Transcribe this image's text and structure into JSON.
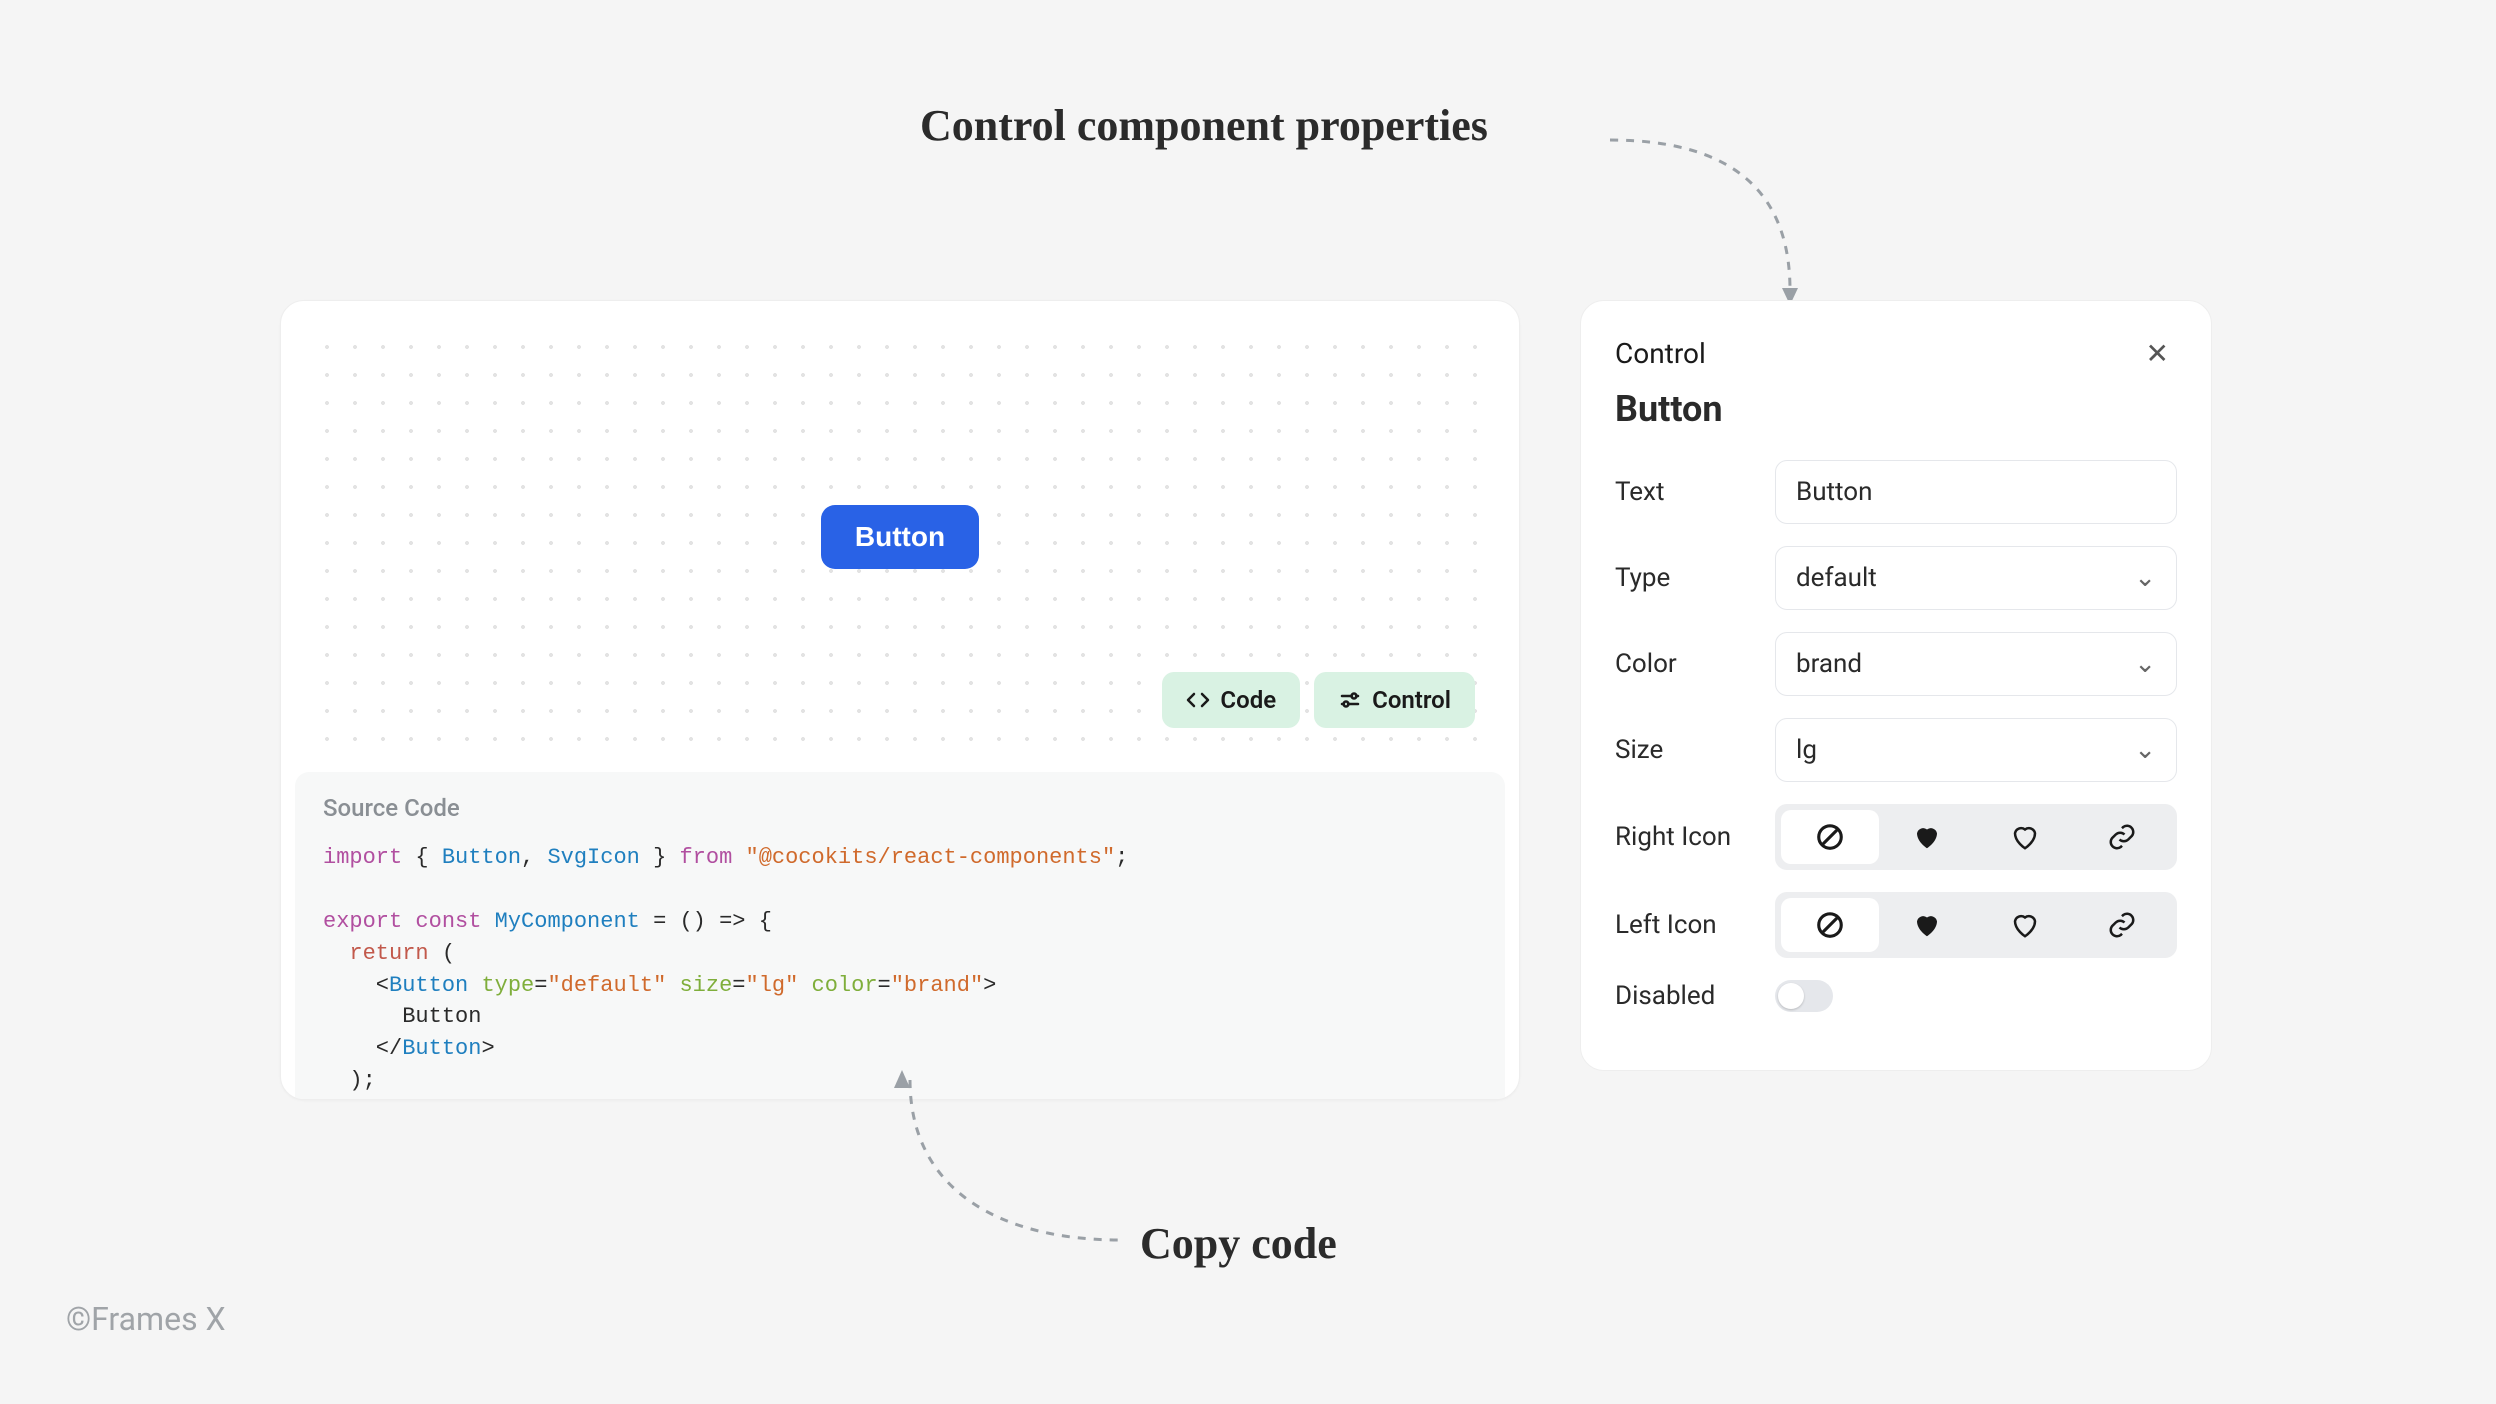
{
  "annotations": {
    "top": "Control component properties",
    "bottom": "Copy code"
  },
  "preview": {
    "button_text": "Button",
    "actions": {
      "code": "Code",
      "control": "Control"
    }
  },
  "source": {
    "title": "Source Code",
    "code": {
      "import_kw": "import",
      "import_names": [
        "Button",
        "SvgIcon"
      ],
      "from_kw": "from",
      "package": "\"@cocokits/react-components\"",
      "export_kw": "export",
      "const_kw": "const",
      "component_name": "MyComponent",
      "return_kw": "return",
      "jsx_tag": "Button",
      "attr_type": "type",
      "val_type": "\"default\"",
      "attr_size": "size",
      "val_size": "\"lg\"",
      "attr_color": "color",
      "val_color": "\"brand\"",
      "inner_text": "Button"
    }
  },
  "control": {
    "panel_title": "Control",
    "component_name": "Button",
    "props": {
      "text": {
        "label": "Text",
        "value": "Button"
      },
      "type": {
        "label": "Type",
        "value": "default"
      },
      "color": {
        "label": "Color",
        "value": "brand"
      },
      "size": {
        "label": "Size",
        "value": "lg"
      },
      "right_icon": {
        "label": "Right Icon",
        "selected": "none"
      },
      "left_icon": {
        "label": "Left Icon",
        "selected": "none"
      },
      "disabled": {
        "label": "Disabled",
        "value": false
      }
    },
    "icon_options": [
      "none",
      "heart-solid",
      "heart-outline",
      "link"
    ]
  },
  "footer": "©Frames X"
}
